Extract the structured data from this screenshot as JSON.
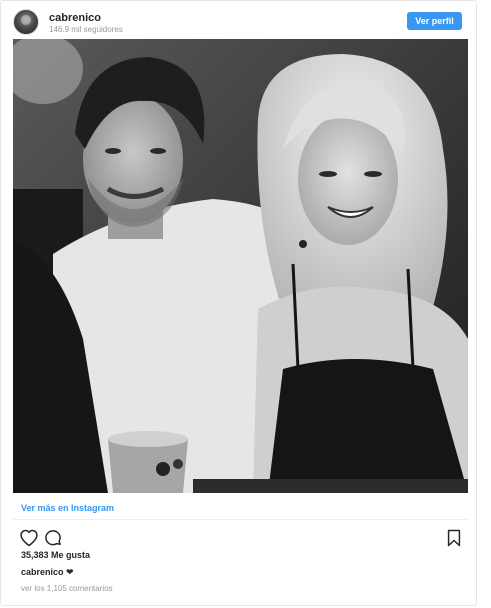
{
  "header": {
    "username": "cabrenico",
    "followers": "146.9 mil seguidores",
    "view_profile_label": "Ver perfil"
  },
  "post": {
    "view_more_label": "Ver más en Instagram",
    "likes": "35,383 Me gusta",
    "caption_user": "cabrenico",
    "caption_text": " ❤",
    "comments_link": "ver los 1,105 comentarios"
  },
  "icons": {
    "like": "heart-outline-icon",
    "comment": "comment-bubble-icon",
    "save": "bookmark-outline-icon"
  },
  "colors": {
    "accent": "#3897f0",
    "text": "#262626",
    "muted": "#999999"
  }
}
